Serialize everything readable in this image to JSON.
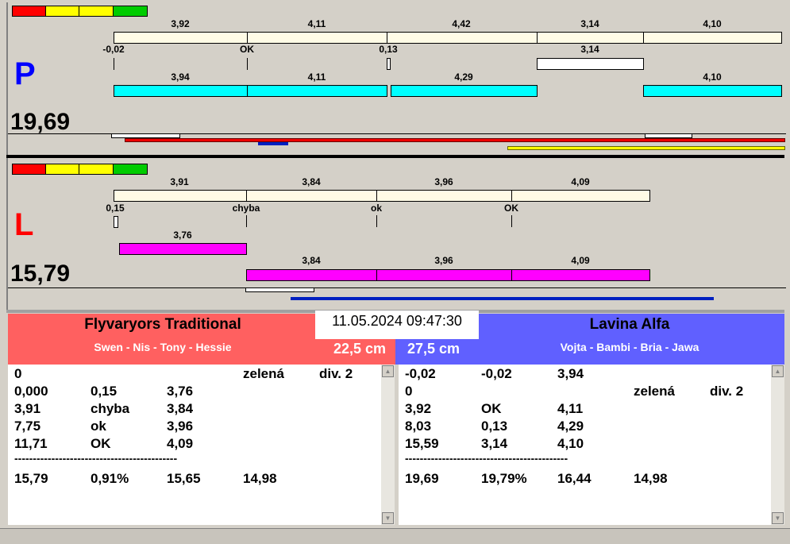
{
  "colors": {
    "red": "#ff0000",
    "yellow": "#ffff00",
    "green": "#00cc00",
    "cream": "#fffbe6",
    "cyan": "#00ffff",
    "magenta": "#ff00ff",
    "team_left": "#ff6060",
    "team_right": "#6060ff"
  },
  "p": {
    "side": "P",
    "total": "19,69",
    "top_labels": [
      "3,92",
      "4,11",
      "4,42",
      "3,14",
      "4,10"
    ],
    "mid_labels": [
      "-0,02",
      "OK",
      "0,13",
      "3,14"
    ],
    "low_labels": [
      "3,94",
      "4,11",
      "4,29",
      "4,10"
    ]
  },
  "l": {
    "side": "L",
    "total": "15,79",
    "top_labels": [
      "3,91",
      "3,84",
      "3,96",
      "4,09"
    ],
    "mid_labels": [
      "0,15",
      "chyba",
      "ok",
      "OK"
    ],
    "first_label": "3,76",
    "low_labels": [
      "3,84",
      "3,96",
      "4,09"
    ]
  },
  "datetime": "11.05.2024 09:47:30",
  "left_team": {
    "name": "Flyvaryors Traditional",
    "members": "Swen - Nis - Tony - Hessie",
    "height": "22,5 cm",
    "rows": [
      [
        "0",
        "",
        "",
        "zelená",
        "div. 2"
      ],
      [
        "0,000",
        "0,15",
        "3,76",
        "",
        ""
      ],
      [
        "3,91",
        "chyba",
        "3,84",
        "",
        ""
      ],
      [
        "7,75",
        "ok",
        "3,96",
        "",
        ""
      ],
      [
        "11,71",
        "OK",
        "4,09",
        "",
        ""
      ]
    ],
    "separator": "--------------------------------------------",
    "summary": [
      "15,79",
      "0,91%",
      "15,65",
      "14,98"
    ]
  },
  "right_team": {
    "name": "Lavina Alfa",
    "members": "Vojta - Bambi - Bria - Jawa",
    "height": "27,5 cm",
    "rows": [
      [
        "-0,02",
        "-0,02",
        "3,94",
        "",
        ""
      ],
      [
        "0",
        "",
        "",
        "zelená",
        "div. 2"
      ],
      [
        "3,92",
        "OK",
        "4,11",
        "",
        ""
      ],
      [
        "8,03",
        "0,13",
        "4,29",
        "",
        ""
      ],
      [
        "15,59",
        "3,14",
        "4,10",
        "",
        ""
      ]
    ],
    "separator": "--------------------------------------------",
    "summary": [
      "19,69",
      "19,79%",
      "16,44",
      "14,98"
    ]
  }
}
